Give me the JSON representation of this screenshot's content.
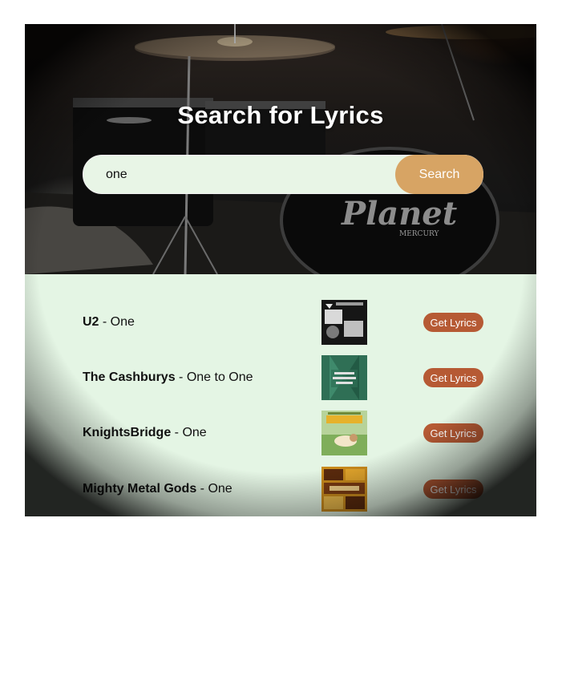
{
  "header": {
    "title": "Search for Lyrics"
  },
  "search": {
    "value": "one",
    "button_label": "Search"
  },
  "hero_image": {
    "drum_brand": "Planet",
    "drum_model": "MERCURY"
  },
  "results": [
    {
      "artist": "U2",
      "separator": " - ",
      "title": "One",
      "button_label": "Get Lyrics",
      "cover": {
        "bg": "#161616",
        "accent": "#8d8d8d",
        "text": ""
      }
    },
    {
      "artist": "The Cashburys",
      "separator": " - ",
      "title": "One to One",
      "button_label": "Get Lyrics",
      "cover": {
        "bg": "#2f6f55",
        "accent": "#d8d8d8",
        "text": "COFFEE HOUSE POP BALLADS"
      }
    },
    {
      "artist": "KnightsBridge",
      "separator": " - ",
      "title": "One",
      "button_label": "Get Lyrics",
      "cover": {
        "bg": "#9fc27a",
        "accent": "#e6b12b",
        "text": "IRISH POP"
      }
    },
    {
      "artist": "Mighty Metal Gods",
      "separator": " - ",
      "title": "One",
      "button_label": "Get Lyrics",
      "cover": {
        "bg": "#c98a1c",
        "accent": "#5a2a0d",
        "text": ""
      }
    }
  ],
  "colors": {
    "search_button": "#d7a464",
    "lyrics_button": "#b65a34",
    "results_bg": "#e4f5e4"
  }
}
